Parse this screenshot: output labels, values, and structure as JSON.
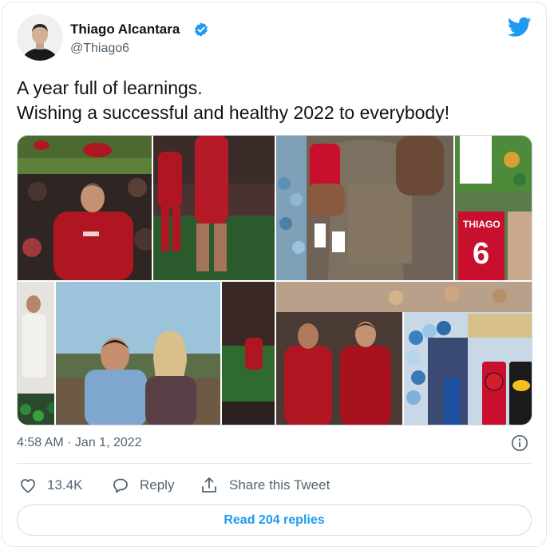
{
  "tweet": {
    "author_name": "Thiago Alcantara",
    "author_handle": "@Thiago6",
    "text_line1": "A year full of learnings.",
    "text_line2": "Wishing a successful and healthy 2022 to everybody!",
    "timestamp": "4:58 AM · Jan 1, 2022",
    "likes": "13.4K",
    "reply_label": "Reply",
    "share_label": "Share this Tweet",
    "read_replies_label": "Read 204 replies",
    "jersey_name": "THIAGO",
    "jersey_number": "6"
  },
  "colors": {
    "brand": "#1d9bf0",
    "text_primary": "#0f1419",
    "text_secondary": "#536471",
    "liverpool_red": "#b01622"
  },
  "icons": [
    "verified-badge-icon",
    "twitter-bird-icon",
    "info-icon",
    "heart-icon",
    "reply-icon",
    "share-icon"
  ],
  "media": [
    "photo-collage-top-left",
    "photo-collage-top-right",
    "photo-collage-bottom-left",
    "photo-collage-bottom-right"
  ]
}
